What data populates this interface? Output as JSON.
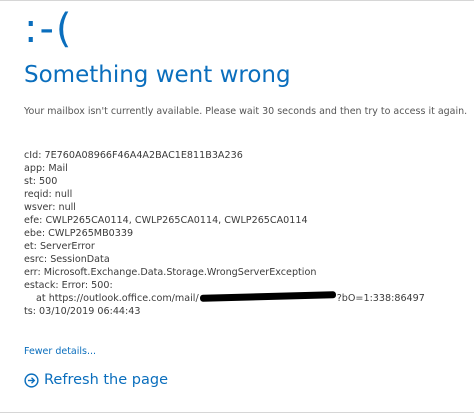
{
  "error": {
    "face": ":-(",
    "title": "Something went wrong",
    "message": "Your mailbox isn't currently available. Please wait 30 seconds and then try to access it again."
  },
  "diagnostics": {
    "cid": "cId: 7E760A08966F46A4A2BAC1E811B3A236",
    "app": "app: Mail",
    "st": "st: 500",
    "reqid": "reqid: null",
    "wsver": "wsver: null",
    "efe": "efe: CWLP265CA0114, CWLP265CA0114, CWLP265CA0114",
    "ebe": "ebe: CWLP265MB0339",
    "et": "et: ServerError",
    "esrc": "esrc: SessionData",
    "err": "err: Microsoft.Exchange.Data.Storage.WrongServerException",
    "estack": "estack: Error: 500:",
    "stack_prefix": "at https://outlook.office.com/mail/",
    "stack_suffix": "?bO=1:338:86497",
    "ts": "ts: 03/10/2019 06:44:43"
  },
  "links": {
    "fewer_details": "Fewer details...",
    "refresh": "Refresh the page"
  },
  "icons": {
    "refresh": "arrow-circle-right-icon"
  },
  "colors": {
    "accent": "#0a6ebd",
    "text": "#3b3b3b",
    "message": "#555555"
  }
}
